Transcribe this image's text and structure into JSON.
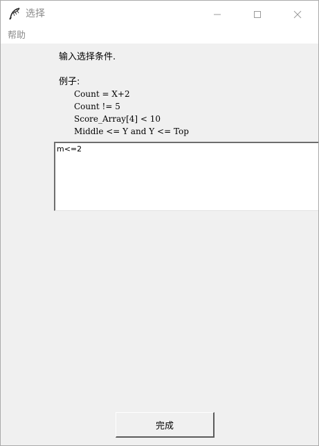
{
  "window": {
    "title": "选择",
    "icon": "feather-pen-icon",
    "controls": {
      "minimize_icon": "minimize-icon",
      "maximize_icon": "maximize-icon",
      "close_icon": "close-icon"
    }
  },
  "menu": {
    "items": [
      {
        "label": "帮助"
      }
    ]
  },
  "dialog": {
    "prompt": "输入选择条件.",
    "examples_label": "例子:",
    "examples": [
      "Count = X+2",
      "Count != 5",
      "Score_Array[4] < 10",
      "Middle <= Y and Y <= Top"
    ],
    "condition_value": "m<=2",
    "done_label": "完成"
  },
  "colors": {
    "titlebar_bg": "#ffffff",
    "client_bg": "#f0f0f0",
    "muted_text": "#8a8a8a",
    "text": "#000000"
  }
}
